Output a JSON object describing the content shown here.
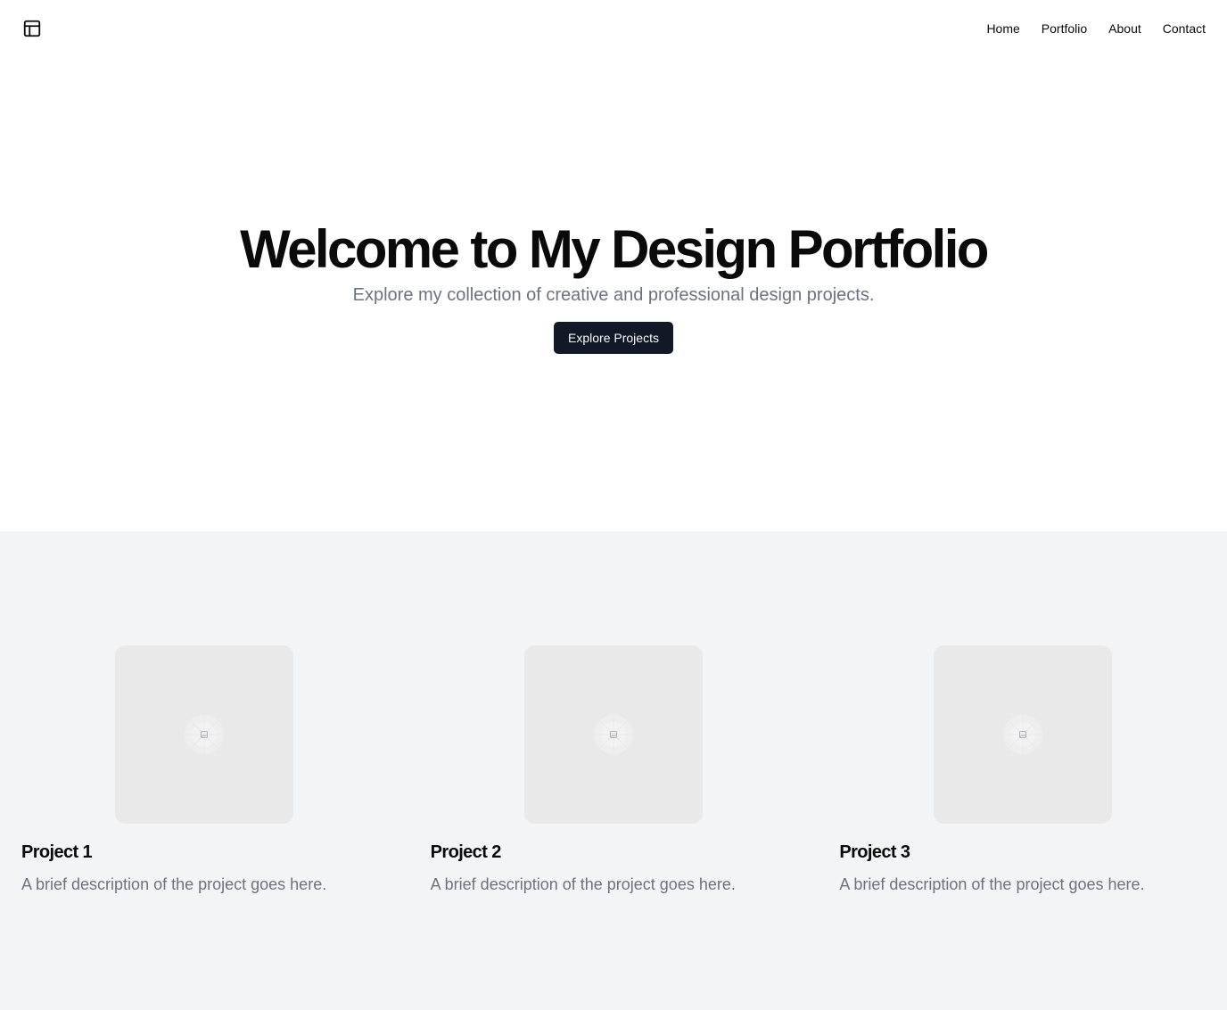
{
  "header": {
    "logo_icon": "layout-panel-icon",
    "nav": [
      {
        "label": "Home"
      },
      {
        "label": "Portfolio"
      },
      {
        "label": "About"
      },
      {
        "label": "Contact"
      }
    ]
  },
  "hero": {
    "title": "Welcome to My Design Portfolio",
    "subtitle": "Explore my collection of creative and professional design projects.",
    "cta_label": "Explore Projects"
  },
  "projects": {
    "items": [
      {
        "title": "Project 1",
        "description": "A brief description of the project goes here.",
        "image_icon": "image-placeholder-icon"
      },
      {
        "title": "Project 2",
        "description": "A brief description of the project goes here.",
        "image_icon": "image-placeholder-icon"
      },
      {
        "title": "Project 3",
        "description": "A brief description of the project goes here.",
        "image_icon": "image-placeholder-icon"
      }
    ]
  },
  "colors": {
    "text": "#0a0a0a",
    "muted": "#6b7280",
    "button_bg": "#111827",
    "section_bg": "#f3f4f6",
    "placeholder_bg": "#e9e9e9"
  }
}
